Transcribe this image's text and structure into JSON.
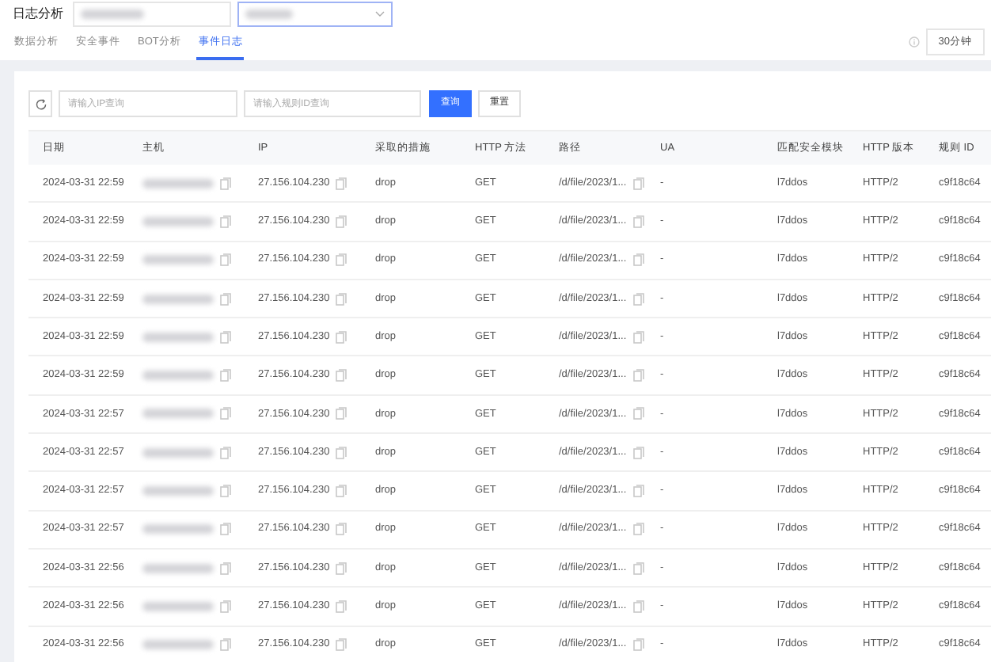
{
  "header": {
    "title": "日志分析",
    "time_range": "30分钟"
  },
  "tabs": [
    {
      "label": "数据分析",
      "selected": false
    },
    {
      "label": "安全事件",
      "selected": false
    },
    {
      "label": "BOT分析",
      "selected": false
    },
    {
      "label": "事件日志",
      "selected": true
    }
  ],
  "filters": {
    "ip_placeholder": "请输入IP查询",
    "rule_placeholder": "请输入规则ID查询",
    "search_button": "查询",
    "reset_button": "重置"
  },
  "table": {
    "columns": [
      "日期",
      "主机",
      "IP",
      "采取的措施",
      "HTTP 方法",
      "路径",
      "UA",
      "匹配安全模块",
      "HTTP 版本",
      "规则 ID"
    ],
    "rows": [
      {
        "date": "2024-03-31 22:59",
        "ip": "27.156.104.230",
        "action": "drop",
        "method": "GET",
        "path": "/d/file/2023/1...",
        "ua": "-",
        "module": "l7ddos",
        "version": "HTTP/2",
        "rule_id": "c9f18c64"
      },
      {
        "date": "2024-03-31 22:59",
        "ip": "27.156.104.230",
        "action": "drop",
        "method": "GET",
        "path": "/d/file/2023/1...",
        "ua": "-",
        "module": "l7ddos",
        "version": "HTTP/2",
        "rule_id": "c9f18c64"
      },
      {
        "date": "2024-03-31 22:59",
        "ip": "27.156.104.230",
        "action": "drop",
        "method": "GET",
        "path": "/d/file/2023/1...",
        "ua": "-",
        "module": "l7ddos",
        "version": "HTTP/2",
        "rule_id": "c9f18c64"
      },
      {
        "date": "2024-03-31 22:59",
        "ip": "27.156.104.230",
        "action": "drop",
        "method": "GET",
        "path": "/d/file/2023/1...",
        "ua": "-",
        "module": "l7ddos",
        "version": "HTTP/2",
        "rule_id": "c9f18c64"
      },
      {
        "date": "2024-03-31 22:59",
        "ip": "27.156.104.230",
        "action": "drop",
        "method": "GET",
        "path": "/d/file/2023/1...",
        "ua": "-",
        "module": "l7ddos",
        "version": "HTTP/2",
        "rule_id": "c9f18c64"
      },
      {
        "date": "2024-03-31 22:59",
        "ip": "27.156.104.230",
        "action": "drop",
        "method": "GET",
        "path": "/d/file/2023/1...",
        "ua": "-",
        "module": "l7ddos",
        "version": "HTTP/2",
        "rule_id": "c9f18c64"
      },
      {
        "date": "2024-03-31 22:57",
        "ip": "27.156.104.230",
        "action": "drop",
        "method": "GET",
        "path": "/d/file/2023/1...",
        "ua": "-",
        "module": "l7ddos",
        "version": "HTTP/2",
        "rule_id": "c9f18c64"
      },
      {
        "date": "2024-03-31 22:57",
        "ip": "27.156.104.230",
        "action": "drop",
        "method": "GET",
        "path": "/d/file/2023/1...",
        "ua": "-",
        "module": "l7ddos",
        "version": "HTTP/2",
        "rule_id": "c9f18c64"
      },
      {
        "date": "2024-03-31 22:57",
        "ip": "27.156.104.230",
        "action": "drop",
        "method": "GET",
        "path": "/d/file/2023/1...",
        "ua": "-",
        "module": "l7ddos",
        "version": "HTTP/2",
        "rule_id": "c9f18c64"
      },
      {
        "date": "2024-03-31 22:57",
        "ip": "27.156.104.230",
        "action": "drop",
        "method": "GET",
        "path": "/d/file/2023/1...",
        "ua": "-",
        "module": "l7ddos",
        "version": "HTTP/2",
        "rule_id": "c9f18c64"
      },
      {
        "date": "2024-03-31 22:56",
        "ip": "27.156.104.230",
        "action": "drop",
        "method": "GET",
        "path": "/d/file/2023/1...",
        "ua": "-",
        "module": "l7ddos",
        "version": "HTTP/2",
        "rule_id": "c9f18c64"
      },
      {
        "date": "2024-03-31 22:56",
        "ip": "27.156.104.230",
        "action": "drop",
        "method": "GET",
        "path": "/d/file/2023/1...",
        "ua": "-",
        "module": "l7ddos",
        "version": "HTTP/2",
        "rule_id": "c9f18c64"
      },
      {
        "date": "2024-03-31 22:56",
        "ip": "27.156.104.230",
        "action": "drop",
        "method": "GET",
        "path": "/d/file/2023/1...",
        "ua": "-",
        "module": "l7ddos",
        "version": "HTTP/2",
        "rule_id": "c9f18c64"
      }
    ]
  }
}
